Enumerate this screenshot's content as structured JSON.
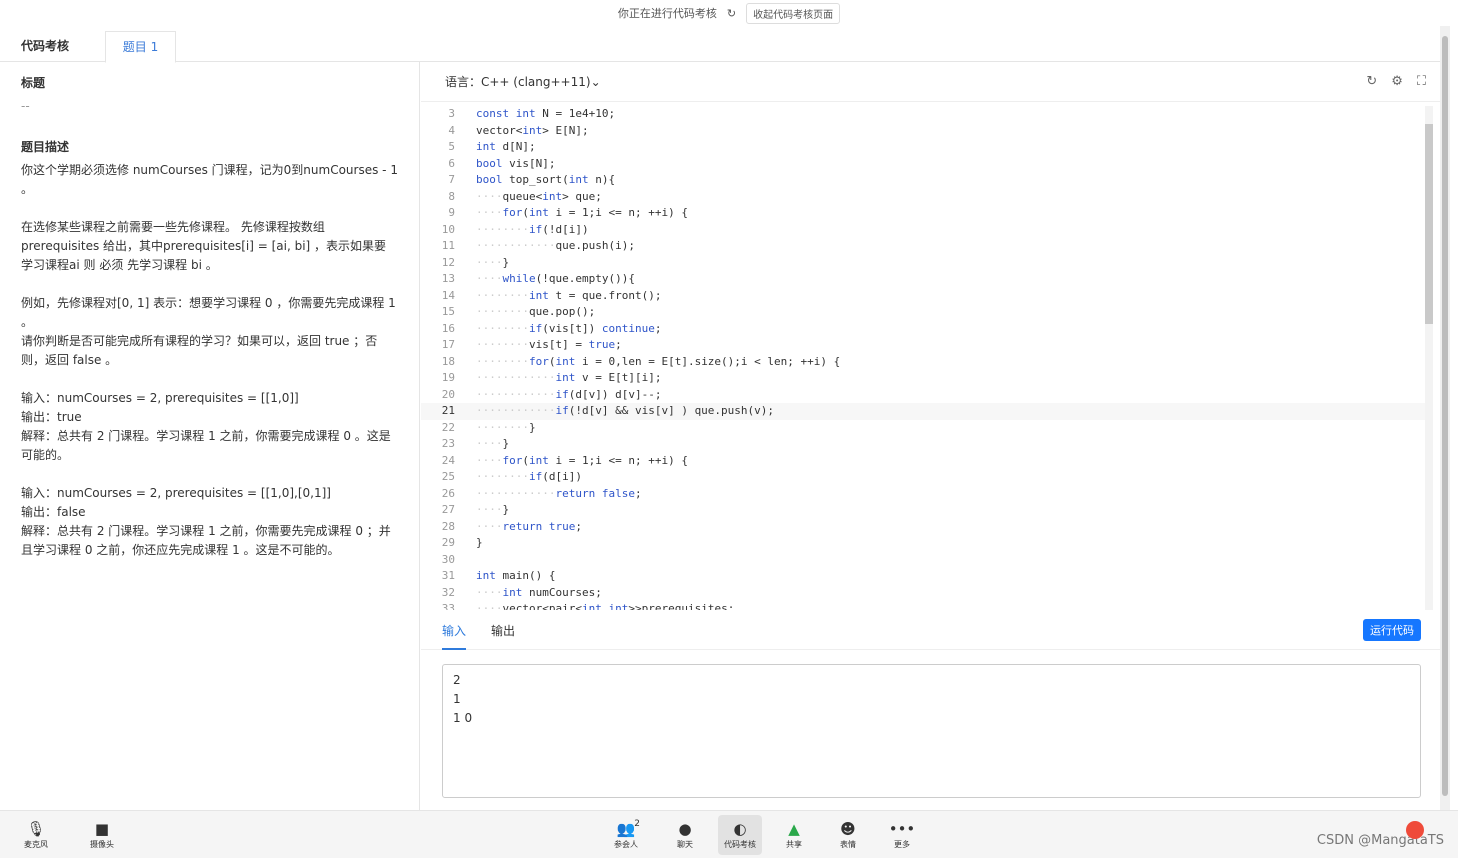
{
  "topbar": {
    "status": "你正在进行代码考核",
    "collapse_button": "收起代码考核页面"
  },
  "tabs": {
    "section": "代码考核",
    "problem_tab": "题目 1"
  },
  "problem": {
    "title_label": "标题",
    "title_value": "--",
    "desc_label": "题目描述",
    "paragraphs": [
      "你这个学期必须选修 numCourses 门课程，记为0到numCourses - 1 。",
      "在选修某些课程之前需要一些先修课程。 先修课程按数组 prerequisites 给出，其中prerequisites[i] = [ai, bi] ，表示如果要学习课程ai 则 必须 先学习课程 bi 。",
      "例如，先修课程对[0, 1] 表示：想要学习课程 0 ，你需要先完成课程 1 。",
      "请你判断是否可能完成所有课程的学习？如果可以，返回 true ；否则，返回 false 。",
      "输入：numCourses = 2, prerequisites = [[1,0]]\n输出：true\n解释：总共有 2 门课程。学习课程 1 之前，你需要完成课程 0 。这是可能的。",
      "输入：numCourses = 2, prerequisites = [[1,0],[0,1]]\n输出：false\n解释：总共有 2 门课程。学习课程 1 之前，你需要先完成课程 0 ；并且学习课程 0 之前，你还应先完成课程 1 。这是不可能的。"
    ]
  },
  "editor": {
    "language": "语言：C++ (clang++11)",
    "current_line": 21,
    "lines": [
      {
        "n": 3,
        "t": "const int N = 1e4+10;"
      },
      {
        "n": 4,
        "t": "vector<int> E[N];"
      },
      {
        "n": 5,
        "t": "int d[N];"
      },
      {
        "n": 6,
        "t": "bool vis[N];"
      },
      {
        "n": 7,
        "t": "bool top_sort(int n){"
      },
      {
        "n": 8,
        "t": "    queue<int> que;"
      },
      {
        "n": 9,
        "t": "    for(int i = 1;i <= n; ++i) {"
      },
      {
        "n": 10,
        "t": "        if(!d[i])"
      },
      {
        "n": 11,
        "t": "            que.push(i);"
      },
      {
        "n": 12,
        "t": "    }"
      },
      {
        "n": 13,
        "t": "    while(!que.empty()){"
      },
      {
        "n": 14,
        "t": "        int t = que.front();"
      },
      {
        "n": 15,
        "t": "        que.pop();"
      },
      {
        "n": 16,
        "t": "        if(vis[t]) continue;"
      },
      {
        "n": 17,
        "t": "        vis[t] = true;"
      },
      {
        "n": 18,
        "t": "        for(int i = 0,len = E[t].size();i < len; ++i) {"
      },
      {
        "n": 19,
        "t": "            int v = E[t][i];"
      },
      {
        "n": 20,
        "t": "            if(d[v]) d[v]--;"
      },
      {
        "n": 21,
        "t": "            if(!d[v] && vis[v] ) que.push(v);"
      },
      {
        "n": 22,
        "t": "        }"
      },
      {
        "n": 23,
        "t": "    }"
      },
      {
        "n": 24,
        "t": "    for(int i = 1;i <= n; ++i) {"
      },
      {
        "n": 25,
        "t": "        if(d[i])"
      },
      {
        "n": 26,
        "t": "            return false;"
      },
      {
        "n": 27,
        "t": "    }"
      },
      {
        "n": 28,
        "t": "    return true;"
      },
      {
        "n": 29,
        "t": "}"
      },
      {
        "n": 30,
        "t": ""
      },
      {
        "n": 31,
        "t": "int main() {"
      },
      {
        "n": 32,
        "t": "    int numCourses;"
      },
      {
        "n": 33,
        "t": "    vector<pair<int,int>>prerequisites;"
      }
    ]
  },
  "io": {
    "input_tab": "输入",
    "output_tab": "输出",
    "run_button": "运行代码",
    "input_value": "2\n1\n1 0"
  },
  "bottom": {
    "items": [
      {
        "icon": "mic-icon",
        "glyph": "🎙",
        "label": "麦克风"
      },
      {
        "icon": "camera-icon",
        "glyph": "■",
        "label": "摄像头"
      },
      {
        "icon": "participants-icon",
        "glyph": "👥",
        "label": "参会人"
      },
      {
        "icon": "chat-icon",
        "glyph": "●",
        "label": "聊天"
      },
      {
        "icon": "code-review-icon",
        "glyph": "◐",
        "label": "代码考核"
      },
      {
        "icon": "share-icon",
        "glyph": "▲",
        "label": "共享"
      },
      {
        "icon": "emoji-icon",
        "glyph": "☻",
        "label": "表情"
      },
      {
        "icon": "more-icon",
        "glyph": "•••",
        "label": "更多"
      }
    ],
    "participants_count": "2",
    "watermark": "CSDN @MangataTS"
  }
}
